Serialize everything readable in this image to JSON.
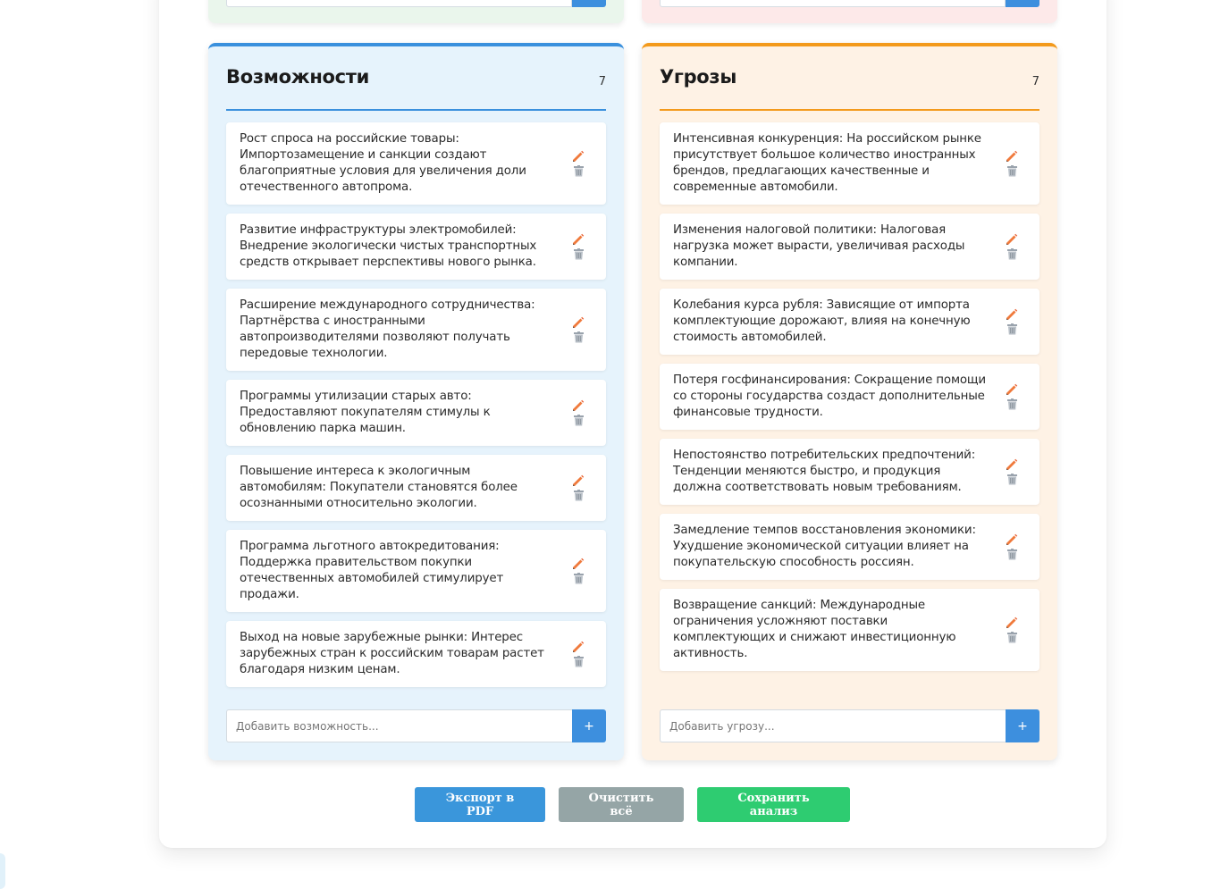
{
  "opportunities": {
    "title": "Возможности",
    "count": "7",
    "accent": "#3a90dd",
    "background": "#e6f3fc",
    "items": [
      "Рост спроса на российские товары: Импортозамещение и санкции создают благоприятные условия для увеличения доли отечественного автопрома.",
      "Развитие инфраструктуры электромобилей: Внедрение экологически чистых транспортных средств открывает перспективы нового рынка.",
      "Расширение международного сотрудничества: Партнёрства с иностранными автопроизводителями позволяют получать передовые технологии.",
      "Программы утилизации старых авто: Предоставляют покупателям стимулы к обновлению парка машин.",
      "Повышение интереса к экологичным автомобилям: Покупатели становятся более осознанными относительно экологии.",
      "Программа льготного автокредитования: Поддержка правительством покупки отечественных автомобилей стимулирует продажи.",
      "Выход на новые зарубежные рынки: Интерес зарубежных стран к российским товарам растет благодаря низким ценам."
    ],
    "input_placeholder": "Добавить возможность...",
    "add_label": "+"
  },
  "threats": {
    "title": "Угрозы",
    "count": "7",
    "accent": "#f39a1c",
    "background": "#fef2e5",
    "items": [
      "Интенсивная конкуренция: На российском рынке присутствует большое количество иностранных брендов, предлагающих качественные и современные автомобили.",
      "Изменения налоговой политики: Налоговая нагрузка может вырасти, увеличивая расходы компании.",
      "Колебания курса рубля: Зависящие от импорта комплектующие дорожают, влияя на конечную стоимость автомобилей.",
      "Потеря госфинансирования: Сокращение помощи со стороны государства создаст дополнительные финансовые трудности.",
      "Непостоянство потребительских предпочтений: Тенденции меняются быстро, и продукция должна соответствовать новым требованиям.",
      "Замедление темпов восстановления экономики: Ухудшение экономической ситуации влияет на покупательскую способность россиян.",
      "Возвращение санкций: Международные ограничения усложняют поставки комплектующих и снижают инвестиционную активность."
    ],
    "input_placeholder": "Добавить угрозу...",
    "add_label": "+"
  },
  "item_icons": {
    "edit": "pencil-icon",
    "delete": "trash-icon"
  },
  "actions": {
    "export_label": "Экспорт в PDF",
    "clear_label": "Очистить всё",
    "save_label": "Сохранить анализ"
  },
  "colors": {
    "primary_button": "#3a96db",
    "clear_button": "#95a5a6",
    "save_button": "#2ecc71",
    "strengths_panel_bg": "#eaf6ec",
    "weaknesses_panel_bg": "#fde9e9"
  }
}
